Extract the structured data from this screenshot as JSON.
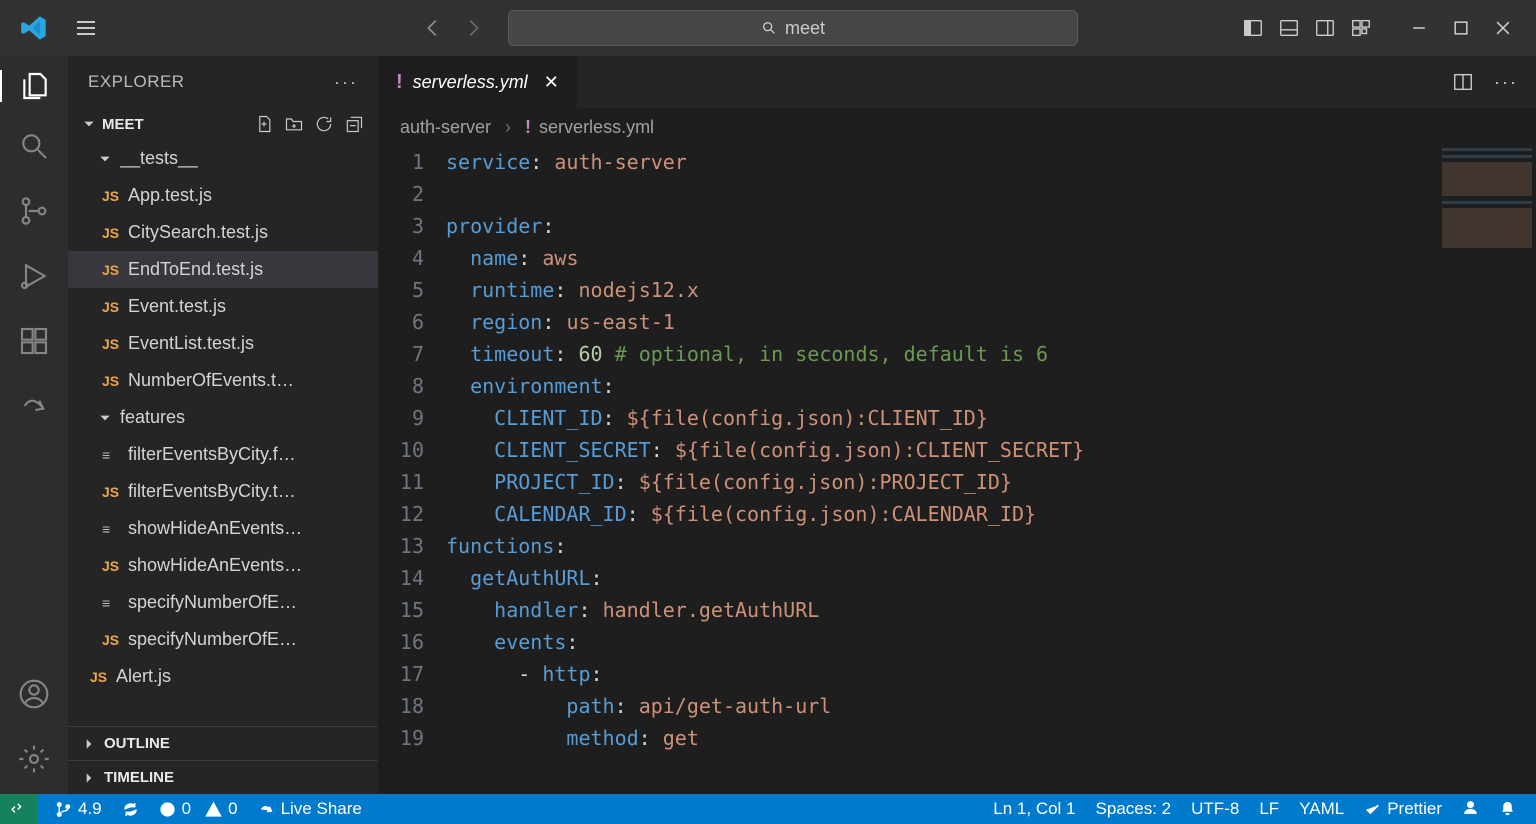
{
  "titlebar": {
    "search_text": "meet"
  },
  "sidebar": {
    "title": "EXPLORER",
    "section": "MEET",
    "folders": {
      "tests": "__tests__",
      "features": "features"
    },
    "files": {
      "f0": "App.test.js",
      "f1": "CitySearch.test.js",
      "f2": "EndToEnd.test.js",
      "f3": "Event.test.js",
      "f4": "EventList.test.js",
      "f5": "NumberOfEvents.t…",
      "f6": "filterEventsByCity.f…",
      "f7": "filterEventsByCity.t…",
      "f8": "showHideAnEvents…",
      "f9": "showHideAnEvents…",
      "f10": "specifyNumberOfE…",
      "f11": "specifyNumberOfE…",
      "f12": "Alert.js"
    },
    "outline": "OUTLINE",
    "timeline": "TIMELINE"
  },
  "tabs": {
    "active": "serverless.yml"
  },
  "breadcrumb": {
    "root": "auth-server",
    "file": "serverless.yml"
  },
  "code": {
    "lines": [
      {
        "n": "1",
        "html": "<span class='tok-key'>service</span>: <span class='tok-str'>auth-server</span>"
      },
      {
        "n": "2",
        "html": ""
      },
      {
        "n": "3",
        "html": "<span class='tok-key'>provider</span>:"
      },
      {
        "n": "4",
        "html": "  <span class='tok-key'>name</span>: <span class='tok-str'>aws</span>"
      },
      {
        "n": "5",
        "html": "  <span class='tok-key'>runtime</span>: <span class='tok-str'>nodejs12.x</span>"
      },
      {
        "n": "6",
        "html": "  <span class='tok-key'>region</span>: <span class='tok-str'>us-east-1</span>"
      },
      {
        "n": "7",
        "html": "  <span class='tok-key'>timeout</span>: <span class='tok-num'>60</span> <span class='tok-com'># optional, in seconds, default is 6</span>"
      },
      {
        "n": "8",
        "html": "  <span class='tok-key'>environment</span>:"
      },
      {
        "n": "9",
        "html": "    <span class='tok-key'>CLIENT_ID</span>: <span class='tok-str'>${file(config.json):CLIENT_ID}</span>"
      },
      {
        "n": "10",
        "html": "    <span class='tok-key'>CLIENT_SECRET</span>: <span class='tok-str'>${file(config.json):CLIENT_SECRET}</span>"
      },
      {
        "n": "11",
        "html": "    <span class='tok-key'>PROJECT_ID</span>: <span class='tok-str'>${file(config.json):PROJECT_ID}</span>"
      },
      {
        "n": "12",
        "html": "    <span class='tok-key'>CALENDAR_ID</span>: <span class='tok-str'>${file(config.json):CALENDAR_ID}</span>"
      },
      {
        "n": "13",
        "html": "<span class='tok-key'>functions</span>:"
      },
      {
        "n": "14",
        "html": "  <span class='tok-key'>getAuthURL</span>:"
      },
      {
        "n": "15",
        "html": "    <span class='tok-key'>handler</span>: <span class='tok-str'>handler.getAuthURL</span>"
      },
      {
        "n": "16",
        "html": "    <span class='tok-key'>events</span>:"
      },
      {
        "n": "17",
        "html": "      - <span class='tok-key'>http</span>:"
      },
      {
        "n": "18",
        "html": "          <span class='tok-key'>path</span>: <span class='tok-str'>api/get-auth-url</span>"
      },
      {
        "n": "19",
        "html": "          <span class='tok-key'>method</span>: <span class='tok-str'>get</span>"
      }
    ]
  },
  "status": {
    "branch": "4.9",
    "errors": "0",
    "warnings": "0",
    "liveshare": "Live Share",
    "cursor": "Ln 1, Col 1",
    "spaces": "Spaces: 2",
    "encoding": "UTF-8",
    "eol": "LF",
    "lang": "YAML",
    "prettier": "Prettier"
  }
}
